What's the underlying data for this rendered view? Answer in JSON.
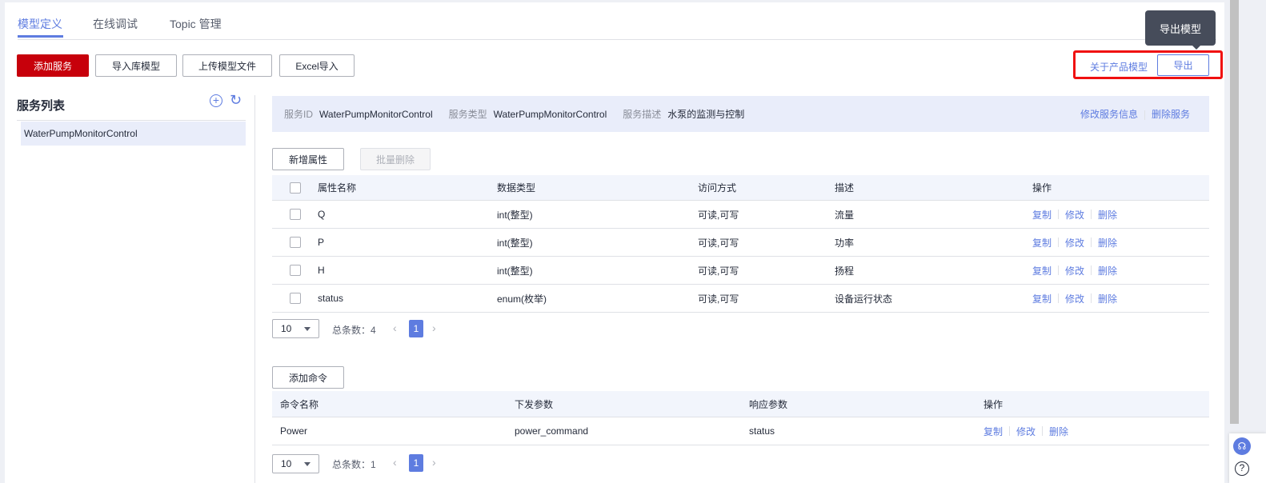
{
  "tabs": [
    {
      "label": "模型定义"
    },
    {
      "label": "在线调试"
    },
    {
      "label": "Topic 管理"
    }
  ],
  "toolbar": {
    "add_service": "添加服务",
    "import_lib": "导入库模型",
    "upload": "上传模型文件",
    "excel": "Excel导入",
    "about": "关于产品模型",
    "export": "导出",
    "export_tooltip": "导出模型"
  },
  "sidebar": {
    "title": "服务列表",
    "items": [
      {
        "label": "WaterPumpMonitorControl"
      }
    ]
  },
  "service": {
    "id_label": "服务ID",
    "id": "WaterPumpMonitorControl",
    "type_label": "服务类型",
    "type": "WaterPumpMonitorControl",
    "desc_label": "服务描述",
    "desc": "水泵的监测与控制",
    "edit": "修改服务信息",
    "delete": "删除服务"
  },
  "properties": {
    "add": "新增属性",
    "batch_delete": "批量删除",
    "headers": [
      "属性名称",
      "数据类型",
      "访问方式",
      "描述",
      "操作"
    ],
    "rows": [
      {
        "name": "Q",
        "type": "int(整型)",
        "access": "可读,可写",
        "desc": "流量"
      },
      {
        "name": "P",
        "type": "int(整型)",
        "access": "可读,可写",
        "desc": "功率"
      },
      {
        "name": "H",
        "type": "int(整型)",
        "access": "可读,可写",
        "desc": "扬程"
      },
      {
        "name": "status",
        "type": "enum(枚举)",
        "access": "可读,可写",
        "desc": "设备运行状态"
      }
    ],
    "page_size": "10",
    "total": "总条数：4",
    "page": "1"
  },
  "ops": {
    "copy": "复制",
    "edit": "修改",
    "delete": "删除"
  },
  "commands": {
    "add": "添加命令",
    "headers": [
      "命令名称",
      "下发参数",
      "响应参数",
      "操作"
    ],
    "rows": [
      {
        "name": "Power",
        "params": "power_command",
        "response": "status"
      }
    ],
    "page_size": "10",
    "total": "总条数：1",
    "page": "1"
  },
  "float": {
    "help": "?"
  }
}
